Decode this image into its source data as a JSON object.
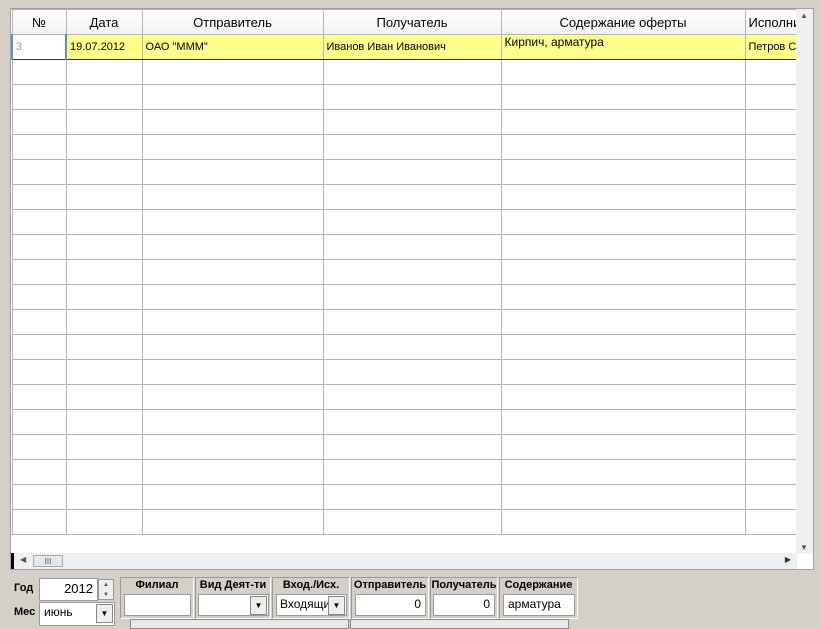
{
  "grid": {
    "columns": [
      "№",
      "Дата",
      "Отправитель",
      "Получатель",
      "Содержание оферты",
      "Исполни"
    ],
    "rows": [
      {
        "num": "3",
        "date": "19.07.2012",
        "sender": "ОАО \"МММ\"",
        "recipient": "Иванов Иван Иванович",
        "content": "Кирпич, арматура",
        "executor": "Петров С"
      }
    ],
    "selected_row_color": "#ffff8c"
  },
  "filters": {
    "year_label": "Год",
    "year": "2012",
    "month_label": "Мес",
    "month": "июнь",
    "branch_label": "Филиал",
    "branch": "",
    "activity_label": "Вид Деят-ти",
    "activity": "",
    "direction_label": "Вход./Исх.",
    "direction": "Входящи",
    "sender_label": "Отправитель",
    "sender": "0",
    "recipient_label": "Получатель",
    "recipient": "0",
    "content_label": "Содержание",
    "content": "арматура"
  }
}
